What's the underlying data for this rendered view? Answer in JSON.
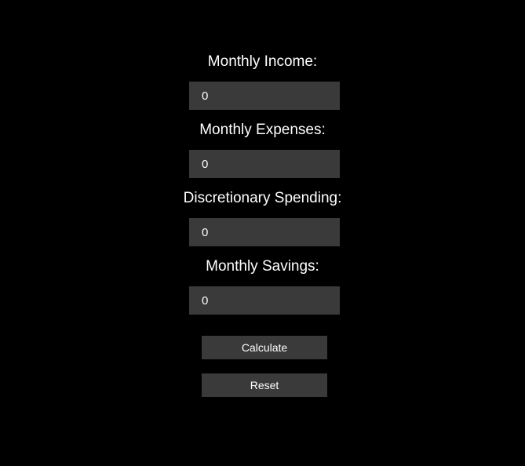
{
  "form": {
    "fields": [
      {
        "label": "Monthly Income:",
        "value": "0"
      },
      {
        "label": "Monthly Expenses:",
        "value": "0"
      },
      {
        "label": "Discretionary Spending:",
        "value": "0"
      },
      {
        "label": "Monthly Savings:",
        "value": "0"
      }
    ],
    "buttons": {
      "calculate_label": "Calculate",
      "reset_label": "Reset"
    }
  },
  "colors": {
    "background": "#000000",
    "control": "#3a3a3a",
    "text": "#ffffff"
  }
}
